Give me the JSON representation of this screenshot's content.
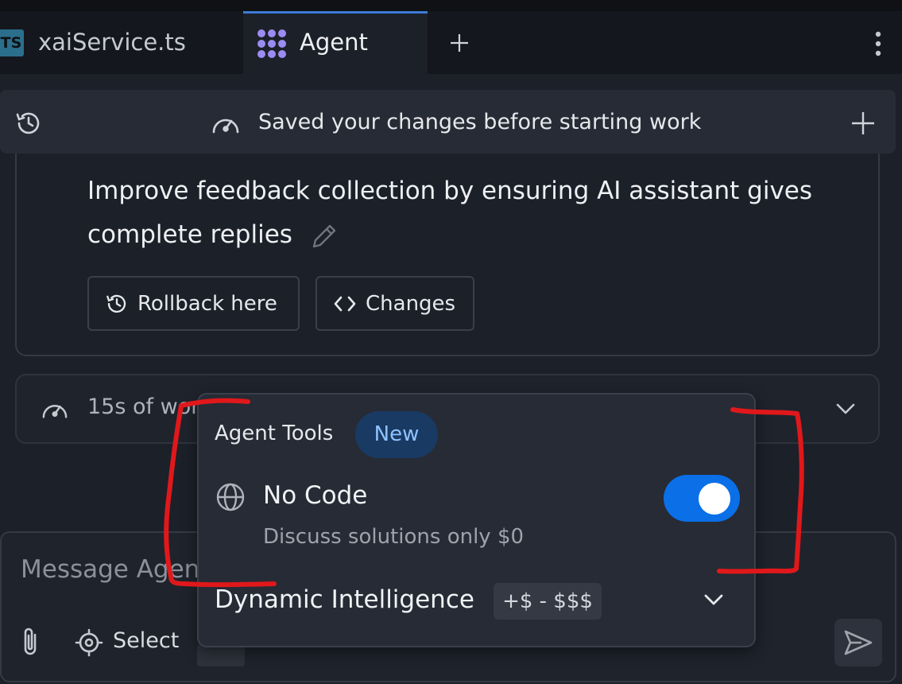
{
  "tabs": {
    "file_tab": {
      "label": "xaiService.ts",
      "badge": "TS",
      "icon": "typescript-file-icon"
    },
    "agent_tab": {
      "label": "Agent",
      "icon": "agent-icon",
      "active": true
    },
    "new_tab_icon": "plus-icon",
    "more_icon": "kebab-menu-icon"
  },
  "banner": {
    "text": "Saved your changes before starting work",
    "left_icon": "history-icon",
    "status_icon": "gauge-icon",
    "right_icon": "plus-icon"
  },
  "message": {
    "line1": "Improve feedback collection by ensuring AI assistant gives",
    "line2": "complete replies",
    "edit_icon": "pencil-icon",
    "buttons": {
      "rollback": "Rollback here",
      "changes": "Changes"
    }
  },
  "work_summary": {
    "text": "15s of wor"
  },
  "composer": {
    "placeholder": "Message Agen",
    "select_label": "Select",
    "attach_icon": "paperclip-icon",
    "select_icon": "target-icon",
    "send_icon": "send-icon"
  },
  "agent_tools_popup": {
    "title": "Agent Tools",
    "badge": "New",
    "no_code": {
      "label": "No Code",
      "description": "Discuss solutions only $0",
      "enabled": true,
      "icon": "globe-icon"
    },
    "dynamic_intelligence": {
      "label": "Dynamic Intelligence",
      "cost": "+$ - $$$",
      "icon": "chevron-down-icon"
    }
  },
  "colors": {
    "background": "#1c2029",
    "tab_bar": "#14171d",
    "accent": "#0b6fe8",
    "active_tab_border": "#3d7bd6",
    "badge_bg": "#193a63",
    "badge_text": "#8fc2ff",
    "annotation": "#e0181b"
  }
}
